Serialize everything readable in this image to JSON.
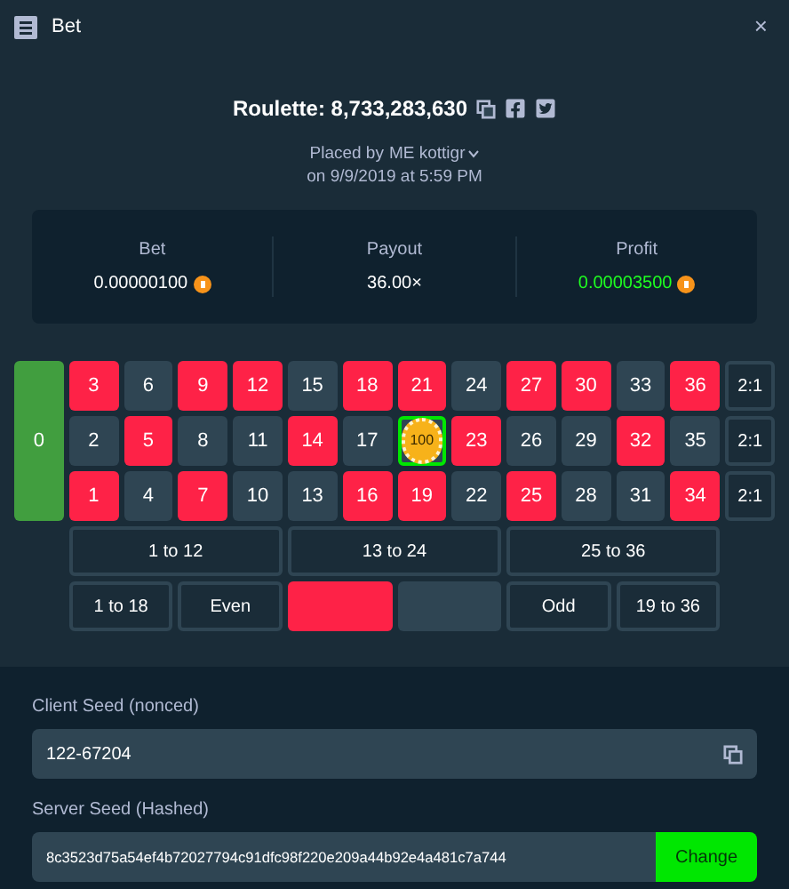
{
  "window": {
    "title": "Bet",
    "close": "×"
  },
  "bet_title": "Roulette: 8,733,283,630",
  "placed": {
    "prefix": "Placed by",
    "user": "ME kottigr",
    "date": "on 9/9/2019 at 5:59 PM"
  },
  "stats": [
    {
      "label": "Bet",
      "value": "0.00000100",
      "coin": true,
      "positive": false
    },
    {
      "label": "Payout",
      "value": "36.00×",
      "coin": false,
      "positive": false
    },
    {
      "label": "Profit",
      "value": "0.00003500",
      "coin": true,
      "positive": true
    }
  ],
  "zero_pocket": {
    "label": "0",
    "color": "#419e3f"
  },
  "board": {
    "number_rows": [
      [
        {
          "label": "3",
          "color": "#fe2247"
        },
        {
          "label": "6",
          "color": "#2f4553"
        },
        {
          "label": "9",
          "color": "#fe2247"
        },
        {
          "label": "12",
          "color": "#fe2247"
        },
        {
          "label": "15",
          "color": "#2f4553"
        },
        {
          "label": "18",
          "color": "#fe2247"
        },
        {
          "label": "21",
          "color": "#fe2247"
        },
        {
          "label": "24",
          "color": "#2f4553"
        },
        {
          "label": "27",
          "color": "#fe2247"
        },
        {
          "label": "30",
          "color": "#fe2247"
        },
        {
          "label": "33",
          "color": "#2f4553"
        },
        {
          "label": "36",
          "color": "#fe2247"
        }
      ],
      [
        {
          "label": "2",
          "color": "#2f4553"
        },
        {
          "label": "5",
          "color": "#fe2247"
        },
        {
          "label": "8",
          "color": "#2f4553"
        },
        {
          "label": "11",
          "color": "#2f4553"
        },
        {
          "label": "14",
          "color": "#fe2247"
        },
        {
          "label": "17",
          "color": "#2f4553"
        },
        {
          "color": "#2f4553",
          "chip": "100"
        },
        {
          "label": "23",
          "color": "#fe2247"
        },
        {
          "label": "26",
          "color": "#2f4553"
        },
        {
          "label": "29",
          "color": "#2f4553"
        },
        {
          "label": "32",
          "color": "#fe2247"
        },
        {
          "label": "35",
          "color": "#2f4553"
        }
      ],
      [
        {
          "label": "1",
          "color": "#fe2247"
        },
        {
          "label": "4",
          "color": "#2f4553"
        },
        {
          "label": "7",
          "color": "#fe2247"
        },
        {
          "label": "10",
          "color": "#2f4553"
        },
        {
          "label": "13",
          "color": "#2f4553"
        },
        {
          "label": "16",
          "color": "#fe2247"
        },
        {
          "label": "19",
          "color": "#fe2247"
        },
        {
          "label": "22",
          "color": "#2f4553"
        },
        {
          "label": "25",
          "color": "#fe2247"
        },
        {
          "label": "28",
          "color": "#2f4553"
        },
        {
          "label": "31",
          "color": "#2f4553"
        },
        {
          "label": "34",
          "color": "#fe2247"
        }
      ]
    ],
    "columns": [
      "2:1",
      "2:1",
      "2:1"
    ],
    "dozens": [
      "1 to 12",
      "13 to 24",
      "25 to 36"
    ],
    "outside": [
      {
        "kind": "text",
        "label": "1 to 18"
      },
      {
        "kind": "text",
        "label": "Even"
      },
      {
        "kind": "color",
        "color": "#fe2247"
      },
      {
        "kind": "color",
        "color": "#2f4553"
      },
      {
        "kind": "text",
        "label": "Odd"
      },
      {
        "kind": "text",
        "label": "19 to 36"
      }
    ]
  },
  "client_seed": {
    "label": "Client Seed (nonced)",
    "value": "122-67204"
  },
  "server_seed": {
    "label": "Server Seed (Hashed)",
    "value": "8c3523d75a54ef4b72027794c91dfc98f220e209a44b92e4a481c7a744",
    "button": "Change"
  }
}
